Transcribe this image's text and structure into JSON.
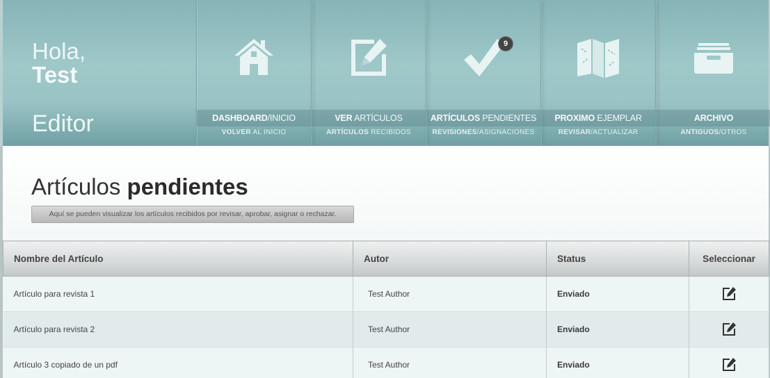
{
  "header": {
    "greeting": "Hola,",
    "user_name": "Test",
    "role": "Editor"
  },
  "nav": [
    {
      "label_bold": "DASHBOARD",
      "label_rest": "/INICIO",
      "sub_bold": "VOLVER",
      "sub_rest": " AL INICIO",
      "icon": "home-icon"
    },
    {
      "label_bold": "VER",
      "label_rest": " ARTÍCULOS",
      "sub_bold": "ARTÍCULOS",
      "sub_rest": " RECIBIDOS",
      "icon": "edit-icon"
    },
    {
      "label_bold": "ARTÍCULOS",
      "label_rest": " PENDIENTES",
      "sub_bold": "REVISIONES",
      "sub_rest": "/ASIGNACIONES",
      "icon": "checkmark-icon",
      "badge": "9"
    },
    {
      "label_bold": "PROXIMO",
      "label_rest": " EJEMPLAR",
      "sub_bold": "REVISAR",
      "sub_rest": "/ACTUALIZAR",
      "icon": "map-icon"
    },
    {
      "label_bold": "ARCHIVO",
      "label_rest": "",
      "sub_bold": "ANTIGUOS",
      "sub_rest": "/OTROS",
      "icon": "archive-icon"
    }
  ],
  "page": {
    "title_light": "Artículos ",
    "title_bold": "pendientes",
    "subtitle": "Aquí se pueden visualizar los artículos recibidos por revisar, aprobar, asignar o rechazar."
  },
  "table": {
    "headers": [
      "Nombre del Artículo",
      "Autor",
      "Status",
      "Seleccionar"
    ],
    "rows": [
      {
        "name": "Artículo para revista 1",
        "author": "Test Author",
        "status": "Enviado"
      },
      {
        "name": "Artículo para revista 2",
        "author": "Test Author",
        "status": "Enviado"
      },
      {
        "name": "Artículo 3 copiado de un pdf",
        "author": "Test Author",
        "status": "Enviado"
      }
    ]
  },
  "colors": {
    "header_teal": "#9fc8c9",
    "icon_light": "#e8f3f3",
    "badge": "#444444"
  }
}
